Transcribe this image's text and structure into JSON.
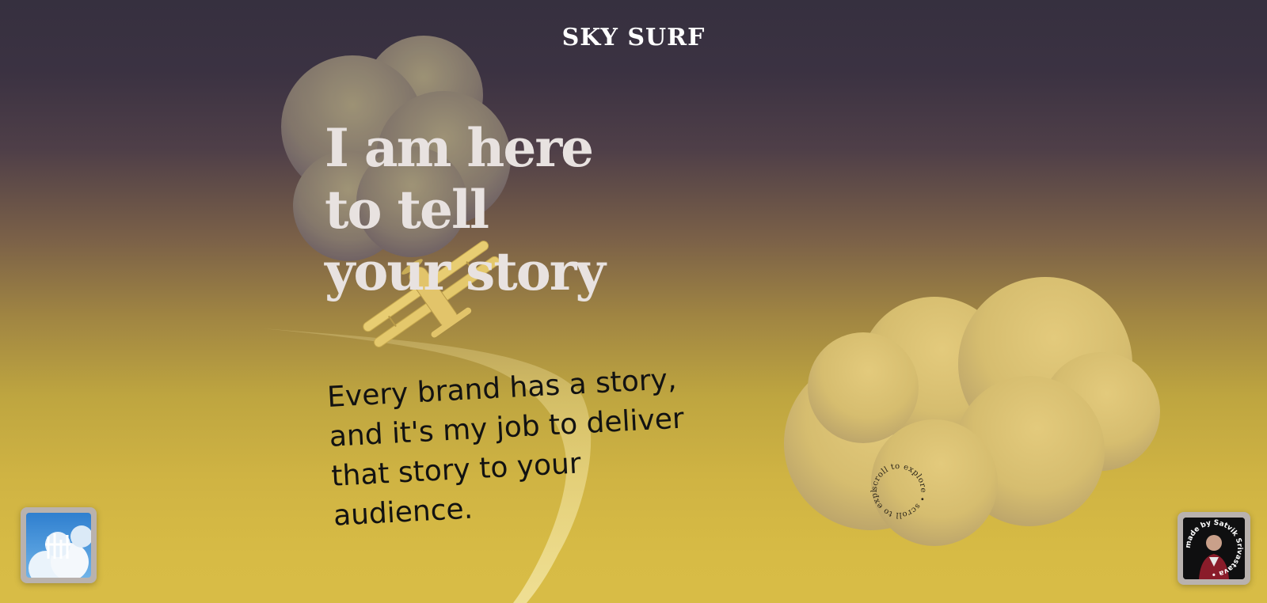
{
  "header": {
    "title": "SKY SURF"
  },
  "hero": {
    "headline_lines": [
      "I am here",
      "to tell",
      "your story"
    ],
    "tagline_lines": [
      "Every brand has a story,",
      "and it's my job to deliver",
      "that story to your",
      "audience."
    ]
  },
  "scroll_hint": {
    "text": "scroll to explore • scroll to explore • "
  },
  "credit": {
    "text": "made by Satvik Srivastava • "
  },
  "colors": {
    "sky_top": "#36303f",
    "sky_bottom": "#d8bc46",
    "cloud": "#dcc270",
    "plane": "#ead07a",
    "headline": "#e8e2e0",
    "tagline": "#121212"
  },
  "icons": {
    "left_thumbnail": "sky-logo-icon",
    "right_thumbnail": "author-avatar"
  }
}
